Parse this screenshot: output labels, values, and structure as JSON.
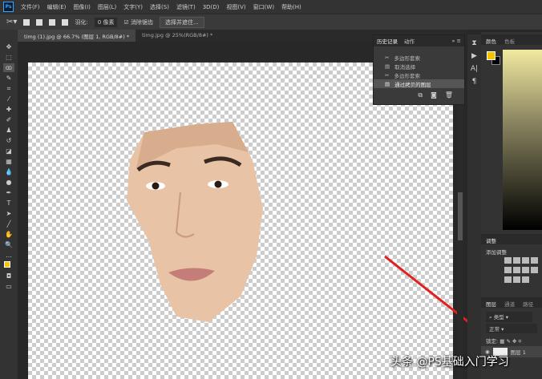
{
  "menu": [
    "文件(F)",
    "编辑(E)",
    "图像(I)",
    "图层(L)",
    "文字(Y)",
    "选择(S)",
    "滤镜(T)",
    "3D(D)",
    "视图(V)",
    "窗口(W)",
    "帮助(H)"
  ],
  "options": {
    "feather_label": "羽化:",
    "feather_value": "0 像素",
    "antialias_label": "消除锯齿",
    "select_mask_button": "选择并遮住..."
  },
  "tabs": [
    "timg (1).jpg @ 66.7% (图层 1, RGB/8#) *",
    "timg.jpg @ 25%(RGB/8#) *"
  ],
  "history": {
    "tabs": [
      "历史记录",
      "动作"
    ],
    "items": [
      "多边形套索",
      "取消选择",
      "多边形套索",
      "通过拷贝的图层"
    ],
    "selected": 3
  },
  "color": {
    "tabs": [
      "颜色",
      "色板"
    ],
    "fg": "#f5c400",
    "bg": "#000000"
  },
  "adjustments": {
    "title": "调整",
    "subtitle": "添加调整"
  },
  "layers": {
    "tabs": [
      "图层",
      "通道",
      "路径"
    ],
    "filter": "类型",
    "blend": "正常",
    "lock_label": "锁定:",
    "layer_name": "图层 1"
  },
  "watermark": "头条 @PS基础入门学习"
}
